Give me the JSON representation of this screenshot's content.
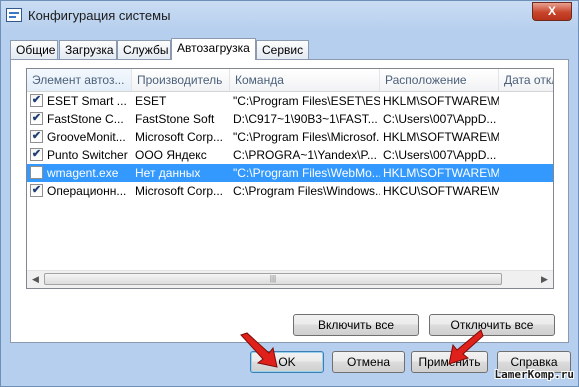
{
  "window": {
    "title": "Конфигурация системы",
    "close_glyph": "X"
  },
  "tabs": [
    {
      "label": "Общие",
      "active": false
    },
    {
      "label": "Загрузка",
      "active": false
    },
    {
      "label": "Службы",
      "active": false
    },
    {
      "label": "Автозагрузка",
      "active": true
    },
    {
      "label": "Сервис",
      "active": false
    }
  ],
  "table": {
    "columns": [
      "Элемент автоз...",
      "Производитель",
      "Команда",
      "Расположение",
      "Дата откл"
    ],
    "rows": [
      {
        "checked": true,
        "item": "ESET Smart ...",
        "maker": "ESET",
        "command": "\"C:\\Program Files\\ESET\\ES...",
        "location": "HKLM\\SOFTWARE\\M...",
        "selected": false
      },
      {
        "checked": true,
        "item": "FastStone C...",
        "maker": "FastStone Soft",
        "command": "D:\\C917~1\\90B3~1\\FAST...",
        "location": "C:\\Users\\007\\AppD...",
        "selected": false
      },
      {
        "checked": true,
        "item": "GrooveMonit...",
        "maker": "Microsoft Corp...",
        "command": "\"C:\\Program Files\\Microsof...",
        "location": "HKLM\\SOFTWARE\\M...",
        "selected": false
      },
      {
        "checked": true,
        "item": "Punto Switcher",
        "maker": "ООО Яндекс",
        "command": "C:\\PROGRA~1\\Yandex\\P...",
        "location": "C:\\Users\\007\\AppD...",
        "selected": false
      },
      {
        "checked": false,
        "item": "wmagent.exe",
        "maker": "Нет данных",
        "command": "\"C:\\Program Files\\WebMo...",
        "location": "HKLM\\SOFTWARE\\M...",
        "selected": true
      },
      {
        "checked": true,
        "item": "Операционн...",
        "maker": "Microsoft Corp...",
        "command": "C:\\Program Files\\Windows...",
        "location": "HKCU\\SOFTWARE\\M...",
        "selected": false
      }
    ],
    "check_glyph": "✔",
    "scroll_left_glyph": "◀",
    "scroll_right_glyph": "▶",
    "thumb_grip": "|||"
  },
  "panel_buttons": {
    "enable_all": "Включить все",
    "disable_all": "Отключить все"
  },
  "dialog_buttons": {
    "ok": "OK",
    "cancel": "Отмена",
    "apply": "Применить",
    "help": "Справка"
  },
  "watermark": "LamerKomp.ru",
  "colors": {
    "selection": "#3399ff",
    "arrow": "#e0201a"
  }
}
